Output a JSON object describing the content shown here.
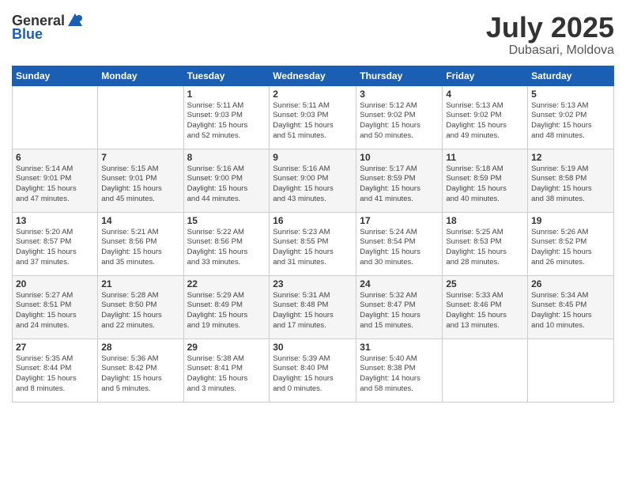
{
  "logo": {
    "general": "General",
    "blue": "Blue"
  },
  "header": {
    "month": "July 2025",
    "location": "Dubasari, Moldova"
  },
  "weekdays": [
    "Sunday",
    "Monday",
    "Tuesday",
    "Wednesday",
    "Thursday",
    "Friday",
    "Saturday"
  ],
  "weeks": [
    [
      {
        "day": "",
        "info": ""
      },
      {
        "day": "",
        "info": ""
      },
      {
        "day": "1",
        "info": "Sunrise: 5:11 AM\nSunset: 9:03 PM\nDaylight: 15 hours\nand 52 minutes."
      },
      {
        "day": "2",
        "info": "Sunrise: 5:11 AM\nSunset: 9:03 PM\nDaylight: 15 hours\nand 51 minutes."
      },
      {
        "day": "3",
        "info": "Sunrise: 5:12 AM\nSunset: 9:02 PM\nDaylight: 15 hours\nand 50 minutes."
      },
      {
        "day": "4",
        "info": "Sunrise: 5:13 AM\nSunset: 9:02 PM\nDaylight: 15 hours\nand 49 minutes."
      },
      {
        "day": "5",
        "info": "Sunrise: 5:13 AM\nSunset: 9:02 PM\nDaylight: 15 hours\nand 48 minutes."
      }
    ],
    [
      {
        "day": "6",
        "info": "Sunrise: 5:14 AM\nSunset: 9:01 PM\nDaylight: 15 hours\nand 47 minutes."
      },
      {
        "day": "7",
        "info": "Sunrise: 5:15 AM\nSunset: 9:01 PM\nDaylight: 15 hours\nand 45 minutes."
      },
      {
        "day": "8",
        "info": "Sunrise: 5:16 AM\nSunset: 9:00 PM\nDaylight: 15 hours\nand 44 minutes."
      },
      {
        "day": "9",
        "info": "Sunrise: 5:16 AM\nSunset: 9:00 PM\nDaylight: 15 hours\nand 43 minutes."
      },
      {
        "day": "10",
        "info": "Sunrise: 5:17 AM\nSunset: 8:59 PM\nDaylight: 15 hours\nand 41 minutes."
      },
      {
        "day": "11",
        "info": "Sunrise: 5:18 AM\nSunset: 8:59 PM\nDaylight: 15 hours\nand 40 minutes."
      },
      {
        "day": "12",
        "info": "Sunrise: 5:19 AM\nSunset: 8:58 PM\nDaylight: 15 hours\nand 38 minutes."
      }
    ],
    [
      {
        "day": "13",
        "info": "Sunrise: 5:20 AM\nSunset: 8:57 PM\nDaylight: 15 hours\nand 37 minutes."
      },
      {
        "day": "14",
        "info": "Sunrise: 5:21 AM\nSunset: 8:56 PM\nDaylight: 15 hours\nand 35 minutes."
      },
      {
        "day": "15",
        "info": "Sunrise: 5:22 AM\nSunset: 8:56 PM\nDaylight: 15 hours\nand 33 minutes."
      },
      {
        "day": "16",
        "info": "Sunrise: 5:23 AM\nSunset: 8:55 PM\nDaylight: 15 hours\nand 31 minutes."
      },
      {
        "day": "17",
        "info": "Sunrise: 5:24 AM\nSunset: 8:54 PM\nDaylight: 15 hours\nand 30 minutes."
      },
      {
        "day": "18",
        "info": "Sunrise: 5:25 AM\nSunset: 8:53 PM\nDaylight: 15 hours\nand 28 minutes."
      },
      {
        "day": "19",
        "info": "Sunrise: 5:26 AM\nSunset: 8:52 PM\nDaylight: 15 hours\nand 26 minutes."
      }
    ],
    [
      {
        "day": "20",
        "info": "Sunrise: 5:27 AM\nSunset: 8:51 PM\nDaylight: 15 hours\nand 24 minutes."
      },
      {
        "day": "21",
        "info": "Sunrise: 5:28 AM\nSunset: 8:50 PM\nDaylight: 15 hours\nand 22 minutes."
      },
      {
        "day": "22",
        "info": "Sunrise: 5:29 AM\nSunset: 8:49 PM\nDaylight: 15 hours\nand 19 minutes."
      },
      {
        "day": "23",
        "info": "Sunrise: 5:31 AM\nSunset: 8:48 PM\nDaylight: 15 hours\nand 17 minutes."
      },
      {
        "day": "24",
        "info": "Sunrise: 5:32 AM\nSunset: 8:47 PM\nDaylight: 15 hours\nand 15 minutes."
      },
      {
        "day": "25",
        "info": "Sunrise: 5:33 AM\nSunset: 8:46 PM\nDaylight: 15 hours\nand 13 minutes."
      },
      {
        "day": "26",
        "info": "Sunrise: 5:34 AM\nSunset: 8:45 PM\nDaylight: 15 hours\nand 10 minutes."
      }
    ],
    [
      {
        "day": "27",
        "info": "Sunrise: 5:35 AM\nSunset: 8:44 PM\nDaylight: 15 hours\nand 8 minutes."
      },
      {
        "day": "28",
        "info": "Sunrise: 5:36 AM\nSunset: 8:42 PM\nDaylight: 15 hours\nand 5 minutes."
      },
      {
        "day": "29",
        "info": "Sunrise: 5:38 AM\nSunset: 8:41 PM\nDaylight: 15 hours\nand 3 minutes."
      },
      {
        "day": "30",
        "info": "Sunrise: 5:39 AM\nSunset: 8:40 PM\nDaylight: 15 hours\nand 0 minutes."
      },
      {
        "day": "31",
        "info": "Sunrise: 5:40 AM\nSunset: 8:38 PM\nDaylight: 14 hours\nand 58 minutes."
      },
      {
        "day": "",
        "info": ""
      },
      {
        "day": "",
        "info": ""
      }
    ]
  ]
}
